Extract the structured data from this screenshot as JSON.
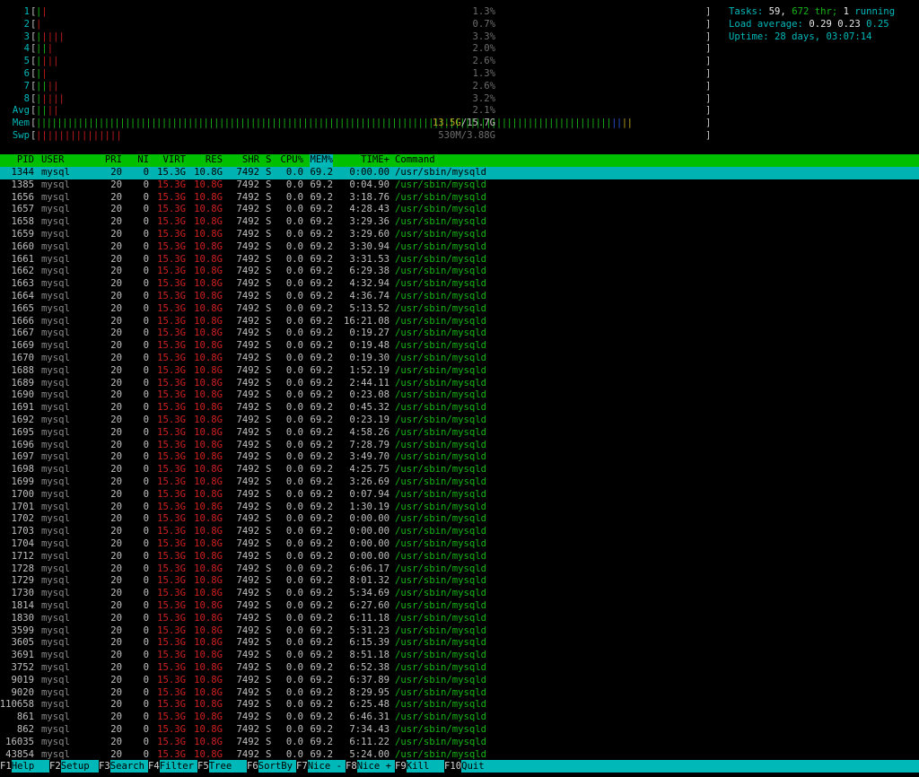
{
  "cpus": [
    {
      "label": "1",
      "pct": "1.3%",
      "green": 1,
      "red": 1
    },
    {
      "label": "2",
      "pct": "0.7%",
      "green": 0,
      "red": 1
    },
    {
      "label": "3",
      "pct": "3.3%",
      "green": 1,
      "red": 4
    },
    {
      "label": "4",
      "pct": "2.0%",
      "green": 2,
      "red": 1
    },
    {
      "label": "5",
      "pct": "2.6%",
      "green": 1,
      "red": 3
    },
    {
      "label": "6",
      "pct": "1.3%",
      "green": 1,
      "red": 1
    },
    {
      "label": "7",
      "pct": "2.6%",
      "green": 2,
      "red": 2
    },
    {
      "label": "8",
      "pct": "3.2%",
      "green": 1,
      "red": 4
    },
    {
      "label": "Avg",
      "pct": "2.1%",
      "green": 2,
      "red": 2
    }
  ],
  "mem": {
    "label": "Mem",
    "value": "13.5G",
    "total": "15.7G",
    "green_bars": 110,
    "blue_bars": 2,
    "yellow_bars": 2
  },
  "swp": {
    "label": "Swp",
    "value": "530M",
    "total": "3.88G",
    "red_bars": 15
  },
  "tasks": {
    "label": "Tasks:",
    "count": "59,",
    "thr": "672",
    "thr_label": "thr;",
    "running": "1",
    "running_label": "running"
  },
  "load": {
    "label": "Load average:",
    "v1": "0.29",
    "v2": "0.23",
    "v3": "0.25"
  },
  "uptime": {
    "label": "Uptime:",
    "value": "28 days, 03:07:14"
  },
  "columns": {
    "pid": "PID",
    "user": "USER",
    "pri": "PRI",
    "ni": "NI",
    "virt": "VIRT",
    "res": "RES",
    "shr": "SHR",
    "s": "S",
    "cpu": "CPU%",
    "mem": "MEM%",
    "time": "TIME+",
    "cmd": "Command"
  },
  "colors": {
    "header_bg": "#00bf00",
    "selected_bg": "#00b3b3",
    "green": "#17b517",
    "red": "#c21a1a",
    "cyan": "#00b8b8"
  },
  "processes": [
    {
      "pid": "1344",
      "time": "0:00.00"
    },
    {
      "pid": "1385",
      "time": "0:04.90"
    },
    {
      "pid": "1656",
      "time": "3:18.76"
    },
    {
      "pid": "1657",
      "time": "4:28.43"
    },
    {
      "pid": "1658",
      "time": "3:29.36"
    },
    {
      "pid": "1659",
      "time": "3:29.60"
    },
    {
      "pid": "1660",
      "time": "3:30.94"
    },
    {
      "pid": "1661",
      "time": "3:31.53"
    },
    {
      "pid": "1662",
      "time": "6:29.38"
    },
    {
      "pid": "1663",
      "time": "4:32.94"
    },
    {
      "pid": "1664",
      "time": "4:36.74"
    },
    {
      "pid": "1665",
      "time": "5:13.52"
    },
    {
      "pid": "1666",
      "time": "16:21.08"
    },
    {
      "pid": "1667",
      "time": "0:19.27"
    },
    {
      "pid": "1669",
      "time": "0:19.48"
    },
    {
      "pid": "1670",
      "time": "0:19.30"
    },
    {
      "pid": "1688",
      "time": "1:52.19"
    },
    {
      "pid": "1689",
      "time": "2:44.11"
    },
    {
      "pid": "1690",
      "time": "0:23.08"
    },
    {
      "pid": "1691",
      "time": "0:45.32"
    },
    {
      "pid": "1692",
      "time": "0:23.19"
    },
    {
      "pid": "1695",
      "time": "4:58.26"
    },
    {
      "pid": "1696",
      "time": "7:28.79"
    },
    {
      "pid": "1697",
      "time": "3:49.70"
    },
    {
      "pid": "1698",
      "time": "4:25.75"
    },
    {
      "pid": "1699",
      "time": "3:26.69"
    },
    {
      "pid": "1700",
      "time": "0:07.94"
    },
    {
      "pid": "1701",
      "time": "1:30.19"
    },
    {
      "pid": "1702",
      "time": "0:00.00"
    },
    {
      "pid": "1703",
      "time": "0:00.00"
    },
    {
      "pid": "1704",
      "time": "0:00.00"
    },
    {
      "pid": "1712",
      "time": "0:00.00"
    },
    {
      "pid": "1728",
      "time": "6:06.17"
    },
    {
      "pid": "1729",
      "time": "8:01.32"
    },
    {
      "pid": "1730",
      "time": "5:34.69"
    },
    {
      "pid": "1814",
      "time": "6:27.60"
    },
    {
      "pid": "1830",
      "time": "6:11.18"
    },
    {
      "pid": "3599",
      "time": "5:31.23"
    },
    {
      "pid": "3605",
      "time": "6:15.39"
    },
    {
      "pid": "3691",
      "time": "8:51.18"
    },
    {
      "pid": "3752",
      "time": "6:52.38"
    },
    {
      "pid": "9019",
      "time": "6:37.89"
    },
    {
      "pid": "9020",
      "time": "8:29.95"
    },
    {
      "pid": "110658",
      "time": "6:25.48"
    },
    {
      "pid": "861",
      "time": "6:46.31"
    },
    {
      "pid": "862",
      "time": "7:34.43"
    },
    {
      "pid": "16035",
      "time": "6:11.22"
    },
    {
      "pid": "43854",
      "time": "5:24.00"
    }
  ],
  "common": {
    "user": "mysql",
    "pri": "20",
    "ni": "0",
    "virt": "15.3G",
    "res": "10.8G",
    "shr": "7492",
    "s": "S",
    "cpu": "0.0",
    "mem": "69.2",
    "cmd": "/usr/sbin/mysqld"
  },
  "selected_index": 0,
  "footer": [
    {
      "key": "F1",
      "label": "Help"
    },
    {
      "key": "F2",
      "label": "Setup"
    },
    {
      "key": "F3",
      "label": "Search"
    },
    {
      "key": "F4",
      "label": "Filter"
    },
    {
      "key": "F5",
      "label": "Tree"
    },
    {
      "key": "F6",
      "label": "SortBy"
    },
    {
      "key": "F7",
      "label": "Nice -"
    },
    {
      "key": "F8",
      "label": "Nice +"
    },
    {
      "key": "F9",
      "label": "Kill"
    },
    {
      "key": "F10",
      "label": "Quit"
    }
  ]
}
